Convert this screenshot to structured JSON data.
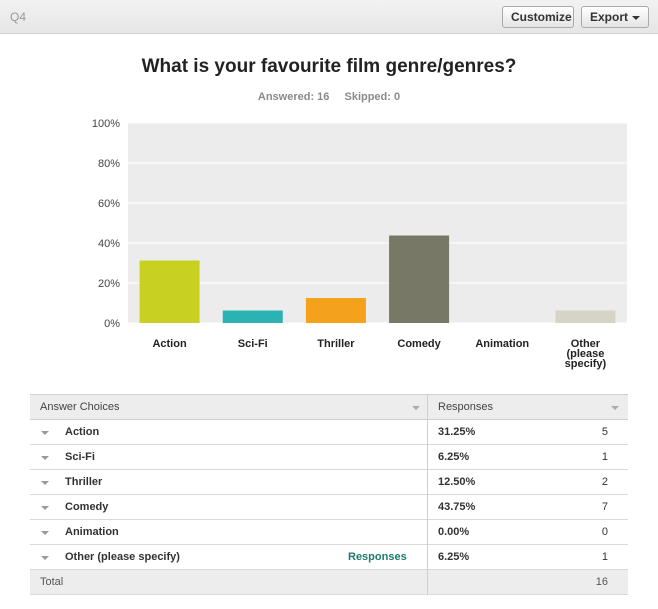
{
  "header": {
    "question_label": "Q4",
    "customize_label": "Customize",
    "export_label": "Export"
  },
  "question": {
    "title": "What is your favourite film genre/genres?",
    "answered": "Answered: 16",
    "skipped": "Skipped: 0"
  },
  "chart_data": {
    "type": "bar",
    "categories": [
      "Action",
      "Sci-Fi",
      "Thriller",
      "Comedy",
      "Animation",
      "Other (please specify)"
    ],
    "category_lines": [
      [
        "Action"
      ],
      [
        "Sci-Fi"
      ],
      [
        "Thriller"
      ],
      [
        "Comedy"
      ],
      [
        "Animation"
      ],
      [
        "Other",
        "(please",
        "specify)"
      ]
    ],
    "values": [
      31.25,
      6.25,
      12.5,
      43.75,
      0,
      6.25
    ],
    "colors": [
      "#c8d021",
      "#2bb2b3",
      "#f4a21b",
      "#777866",
      "#a8a8a8",
      "#d6d4c7"
    ],
    "yticks": [
      "0%",
      "20%",
      "40%",
      "60%",
      "80%",
      "100%"
    ],
    "ylim": [
      0,
      100
    ],
    "grid": true,
    "plot_background": "#ececec"
  },
  "table": {
    "headers": {
      "choices": "Answer Choices",
      "responses": "Responses"
    },
    "rows": [
      {
        "choice": "Action",
        "percent": "31.25%",
        "count": "5"
      },
      {
        "choice": "Sci-Fi",
        "percent": "6.25%",
        "count": "1"
      },
      {
        "choice": "Thriller",
        "percent": "12.50%",
        "count": "2"
      },
      {
        "choice": "Comedy",
        "percent": "43.75%",
        "count": "7"
      },
      {
        "choice": "Animation",
        "percent": "0.00%",
        "count": "0"
      },
      {
        "choice": "Other (please specify)",
        "percent": "6.25%",
        "count": "1",
        "link": "Responses"
      }
    ],
    "total_label": "Total",
    "total_count": "16"
  }
}
